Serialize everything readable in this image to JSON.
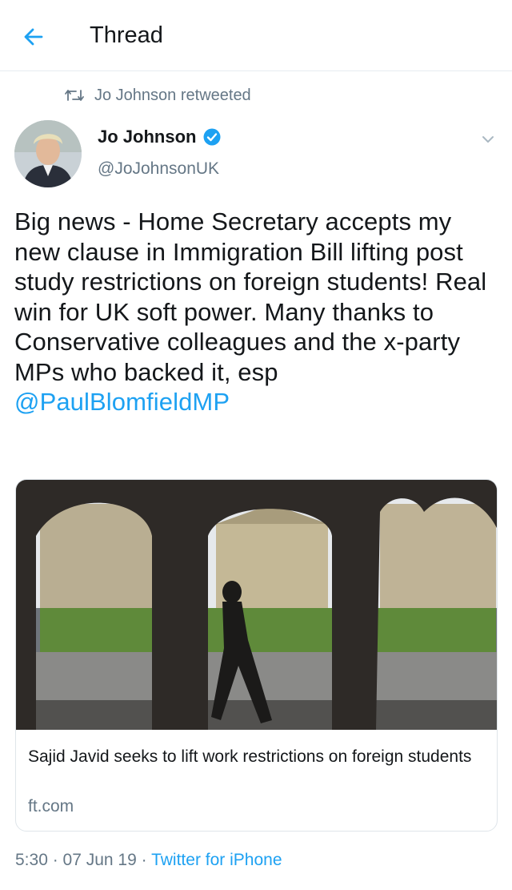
{
  "header": {
    "title": "Thread"
  },
  "retweet": {
    "label": "Jo Johnson retweeted"
  },
  "author": {
    "name": "Jo Johnson",
    "handle": "@JoJohnsonUK"
  },
  "tweet": {
    "text_before_mention": "Big news - Home Secretary accepts my new clause in Immigration Bill lifting post study restrictions on foreign students! Real win for UK soft power. Many thanks to Conservative colleagues and the x-party MPs who backed it, esp ",
    "mention": "@PaulBlomfieldMP"
  },
  "card": {
    "title": "Sajid Javid seeks to lift work restrictions on foreign students",
    "domain": "ft.com"
  },
  "meta": {
    "time": "5:30",
    "separator": " · ",
    "date": "07 Jun 19",
    "source": "Twitter for iPhone"
  },
  "colors": {
    "accent": "#1da1f2",
    "secondary_text": "#657786",
    "text": "#14171a"
  },
  "icons": {
    "back": "arrow-left-icon",
    "retweet": "retweet-icon",
    "verified": "verified-badge-icon",
    "more": "chevron-down-icon"
  }
}
